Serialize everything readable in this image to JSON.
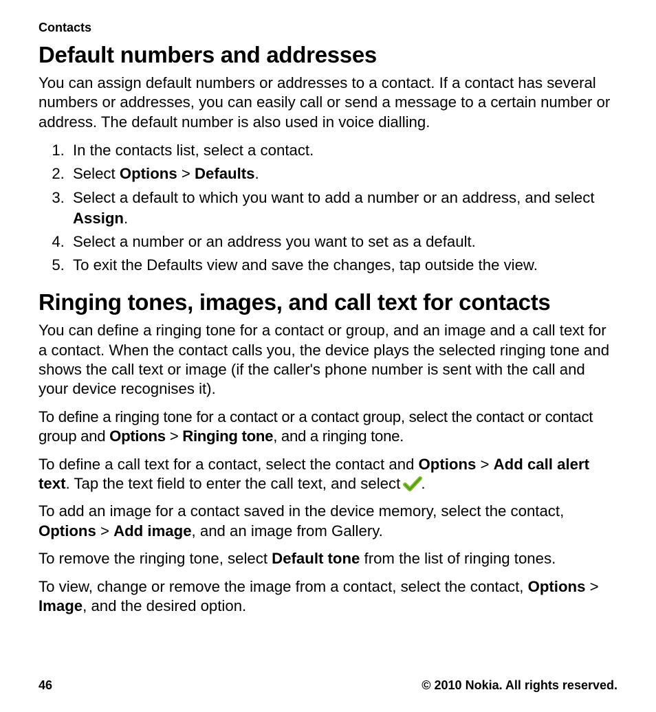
{
  "breadcrumb": "Contacts",
  "section1": {
    "heading": "Default numbers and addresses",
    "intro": "You can assign default numbers or addresses to a contact. If a contact has several numbers or addresses, you can easily call or send a message to a certain number or address. The default number is also used in voice dialling.",
    "steps": {
      "s1": "In the contacts list, select a contact.",
      "s2a": "Select ",
      "s2b": "Options",
      "s2c": " > ",
      "s2d": "Defaults",
      "s2e": ".",
      "s3a": "Select a default to which you want to add a number or an address, and select ",
      "s3b": "Assign",
      "s3c": ".",
      "s4": "Select a number or an address you want to set as a default.",
      "s5": "To exit the Defaults view and save the changes, tap outside the view."
    }
  },
  "section2": {
    "heading": "Ringing tones, images, and call text for contacts",
    "p1": "You can define a ringing tone for a contact or group, and an image and a call text for a contact. When the contact calls you, the device plays the selected ringing tone and shows the call text or image (if the caller's phone number is sent with the call and your device recognises it).",
    "p2": {
      "a": "To define a ringing tone for a contact or a contact group, select the contact or contact group and ",
      "b": "Options",
      "c": " > ",
      "d": "Ringing tone",
      "e": ", and a ringing tone."
    },
    "p3": {
      "a": "To define a call text for a contact, select the contact and ",
      "b": "Options",
      "c": " > ",
      "d": "Add call alert text",
      "e": ". Tap the text field to enter the call text, and select ",
      "f": "."
    },
    "p4": {
      "a": "To add an image for a contact saved in the device memory, select the contact, ",
      "b": "Options",
      "c": " > ",
      "d": "Add image",
      "e": ", and an image from Gallery."
    },
    "p5": {
      "a": "To remove the ringing tone, select ",
      "b": "Default tone",
      "c": " from the list of ringing tones."
    },
    "p6": {
      "a": "To view, change or remove the image from a contact, select the contact, ",
      "b": "Options",
      "c": " > ",
      "d": "Image",
      "e": ", and the desired option."
    }
  },
  "footer": {
    "page": "46",
    "copyright": "© 2010 Nokia. All rights reserved."
  }
}
